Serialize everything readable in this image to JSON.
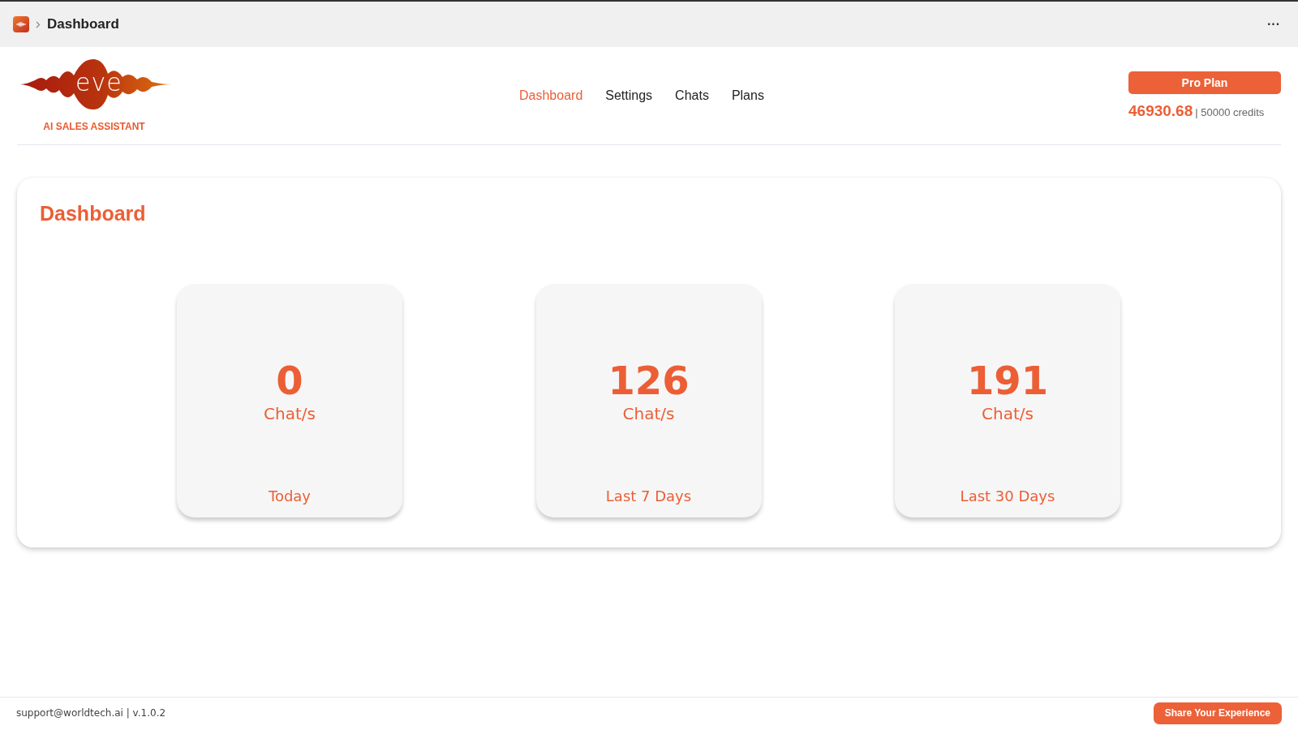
{
  "window": {
    "title": "Dashboard",
    "menu_glyph": "···"
  },
  "header": {
    "logo": {
      "wordmark": "eve",
      "tagline": "AI SALES ASSISTANT"
    },
    "nav": [
      {
        "label": "Dashboard",
        "selected": true
      },
      {
        "label": "Settings",
        "selected": false
      },
      {
        "label": "Chats",
        "selected": false
      },
      {
        "label": "Plans",
        "selected": false
      }
    ],
    "plan_button": "Pro Plan",
    "credits_used": "46930.68",
    "credits_total": "| 50000 credits"
  },
  "dashboard": {
    "title": "Dashboard",
    "stats": [
      {
        "value": "0",
        "unit": "Chat/s",
        "period": "Today"
      },
      {
        "value": "126",
        "unit": "Chat/s",
        "period": "Last 7 Days"
      },
      {
        "value": "191",
        "unit": "Chat/s",
        "period": "Last 30 Days"
      }
    ]
  },
  "footer": {
    "support": "support@worldtech.ai | v.1.0.2",
    "share_button": "Share Your Experience"
  }
}
